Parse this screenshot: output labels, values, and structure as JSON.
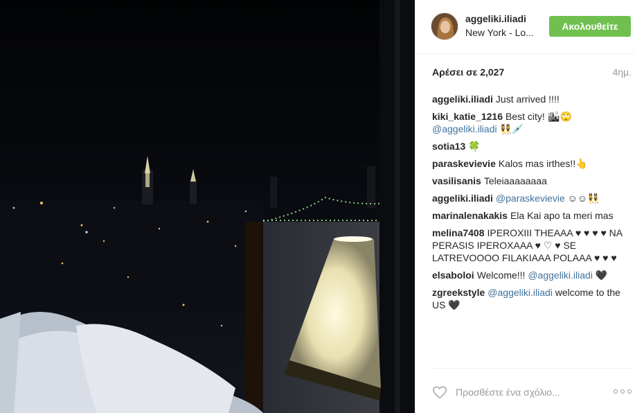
{
  "post": {
    "image_alt": "Night view of New York city skyline from a hotel window with a lamp and bed pillows"
  },
  "header": {
    "username": "aggeliki.iliadi",
    "location": "New York - Lo...",
    "follow_label": "Ακολουθείτε",
    "follow_color": "#70c050"
  },
  "stats": {
    "likes": "Αρέσει σε 2,027",
    "time": "4ημ."
  },
  "comments": [
    {
      "user": "aggeliki.iliadi",
      "text": "Just arrived !!!!",
      "mention": ""
    },
    {
      "user": "kiki_katie_1216",
      "text": "Best city! 🏙🙄",
      "mention": "@aggeliki.iliadi",
      "tail": "👯‍♀️💉"
    },
    {
      "user": "sotia13",
      "text": "🍀",
      "mention": ""
    },
    {
      "user": "paraskevievie",
      "text": "Kalos mas irthes!!👆",
      "mention": ""
    },
    {
      "user": "vasilisanis",
      "text": "Teleiaaaaaaaa",
      "mention": ""
    },
    {
      "user": "aggeliki.iliadi",
      "text": "",
      "mention": "@paraskevievie",
      "tail": "☺☺👯"
    },
    {
      "user": "marinalenakakis",
      "text": "Ela Kai apo ta meri mas",
      "mention": ""
    },
    {
      "user": "melina7408",
      "text": "IPEROXIII THEAAA ♥ ♥ ♥ ♥ NA PERASIS IPEROXAAA ♥ ♡ ♥ SE LATREVOOOO FILAKIAAA POLAAA ♥ ♥ ♥",
      "mention": ""
    },
    {
      "user": "elsaboloi",
      "text": "Welcome!!!",
      "mention": "@aggeliki.iliadi",
      "tail": "🖤"
    },
    {
      "user": "zgreekstyle",
      "text": "",
      "mention": "@aggeliki.iliadi",
      "tail": "welcome to the US 🖤"
    }
  ],
  "footer": {
    "comment_placeholder": "Προσθέστε ένα σχόλιο...",
    "heart_icon": "heart-icon",
    "more_icon": "more-options-icon"
  }
}
